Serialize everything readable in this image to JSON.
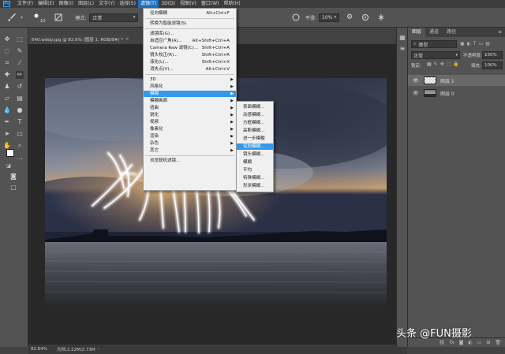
{
  "menubar": {
    "logo": "Ps",
    "items": [
      "文件(F)",
      "编辑(E)",
      "图像(I)",
      "图层(L)",
      "文字(Y)",
      "选择(S)",
      "滤镜(T)",
      "3D(D)",
      "视图(V)",
      "窗口(W)",
      "帮助(H)"
    ],
    "active_index": 6
  },
  "options": {
    "brush_size": "10",
    "mode_label": "模式:",
    "mode_value": "正常",
    "opacity_label": "不透",
    "smoothing_label": "平滑:",
    "smoothing_value": "10%"
  },
  "document": {
    "tab_title": "640.webp.jpg @ 82.6% (图层 1, RGB/8#) *",
    "zoom": "82.64%",
    "doc_size": "文档:2.22M/2.73M"
  },
  "filter_menu": {
    "items": [
      {
        "label": "径向模糊",
        "shortcut": "Alt+Ctrl+F"
      },
      {
        "label": "转换为智能滤镜(S)",
        "shortcut": ""
      },
      {
        "label": "滤镜库(G)...",
        "shortcut": ""
      },
      {
        "label": "自适应广角(A)...",
        "shortcut": "Alt+Shift+Ctrl+A"
      },
      {
        "label": "Camera Raw 滤镜(C)...",
        "shortcut": "Shift+Ctrl+A"
      },
      {
        "label": "镜头校正(R)...",
        "shortcut": "Shift+Ctrl+R"
      },
      {
        "label": "液化(L)...",
        "shortcut": "Shift+Ctrl+X"
      },
      {
        "label": "消失点(V)...",
        "shortcut": "Alt+Ctrl+V"
      },
      {
        "label": "3D",
        "shortcut": ""
      },
      {
        "label": "风格化",
        "shortcut": ""
      },
      {
        "label": "模糊",
        "shortcut": ""
      },
      {
        "label": "模糊画廊",
        "shortcut": ""
      },
      {
        "label": "扭曲",
        "shortcut": ""
      },
      {
        "label": "锐化",
        "shortcut": ""
      },
      {
        "label": "视频",
        "shortcut": ""
      },
      {
        "label": "像素化",
        "shortcut": ""
      },
      {
        "label": "渲染",
        "shortcut": ""
      },
      {
        "label": "杂色",
        "shortcut": ""
      },
      {
        "label": "其它",
        "shortcut": ""
      },
      {
        "label": "浏览联机滤镜...",
        "shortcut": ""
      }
    ],
    "highlighted_index": 10
  },
  "blur_submenu": {
    "items": [
      "表面模糊...",
      "动感模糊...",
      "方框模糊...",
      "高斯模糊...",
      "进一步模糊",
      "径向模糊...",
      "镜头模糊...",
      "模糊",
      "平均",
      "特殊模糊...",
      "形状模糊..."
    ],
    "highlighted_index": 5
  },
  "panels": {
    "tabs": [
      "图层",
      "通道",
      "路径"
    ],
    "kind_filter": "类型",
    "blend_mode": "正常",
    "opacity_label": "不透明度:",
    "opacity_value": "100%",
    "lock_label": "锁定:",
    "fill_label": "填充:",
    "fill_value": "100%",
    "layers": [
      {
        "name": "图层 1"
      },
      {
        "name": "图层 0"
      }
    ]
  },
  "watermark": "头条 @FUN摄影",
  "colors": {
    "foreground": "#ffffff",
    "background": "#e02020",
    "menu_highlight": "#3399e8",
    "menubar_active": "#1e6fc0"
  }
}
